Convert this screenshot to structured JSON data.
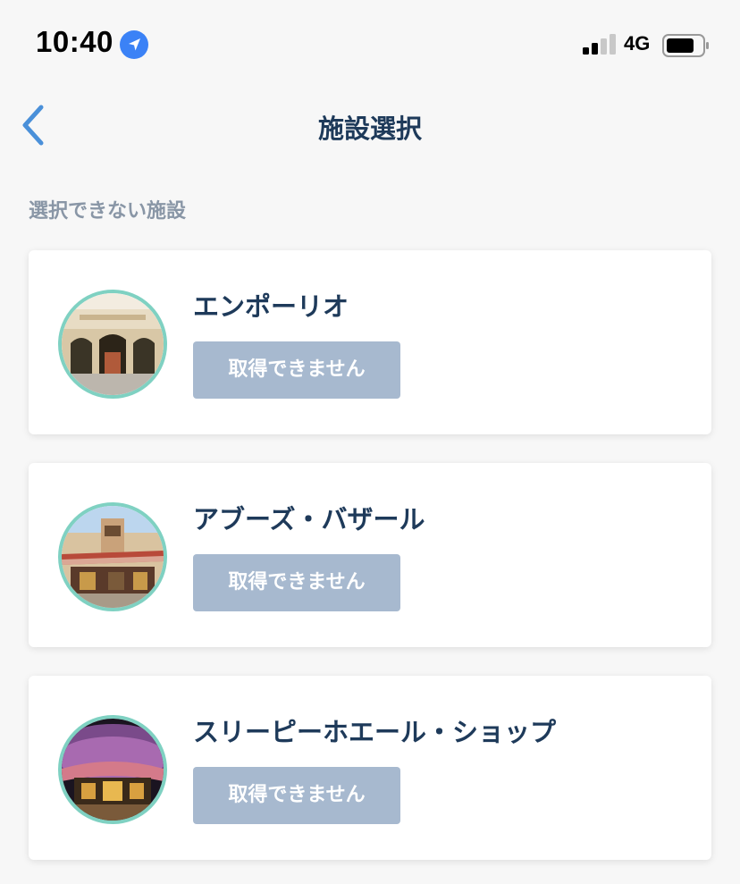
{
  "status_bar": {
    "time": "10:40",
    "network": "4G",
    "icons": [
      "location-arrow-icon",
      "signal-bars-icon",
      "battery-icon"
    ]
  },
  "nav": {
    "title": "施設選択",
    "back_icon": "chevron-left-icon"
  },
  "section": {
    "label": "選択できない施設"
  },
  "facilities": [
    {
      "name": "エンポーリオ",
      "button_label": "取得できません"
    },
    {
      "name": "アブーズ・バザール",
      "button_label": "取得できません"
    },
    {
      "name": "スリーピーホエール・ショップ",
      "button_label": "取得できません"
    }
  ],
  "colors": {
    "accent_blue": "#4a90d9",
    "title_navy": "#1e3a5a",
    "disabled_button": "#a7b9cf",
    "thumb_ring": "#7fd1c2",
    "section_gray": "#8996a6"
  }
}
